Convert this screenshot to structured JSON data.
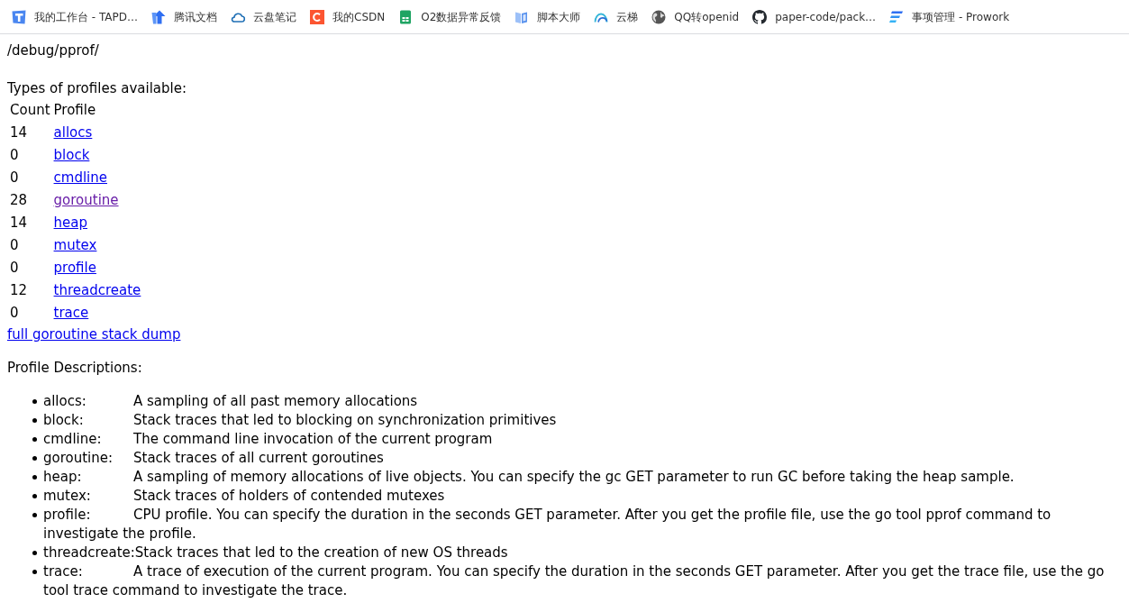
{
  "bookmarks": [
    {
      "label": "我的工作台 - TAPD…"
    },
    {
      "label": "腾讯文档"
    },
    {
      "label": "云盘笔记"
    },
    {
      "label": "我的CSDN"
    },
    {
      "label": "O2数据异常反馈"
    },
    {
      "label": "脚本大师"
    },
    {
      "label": "云梯"
    },
    {
      "label": "QQ转openid"
    },
    {
      "label": "paper-code/pack…"
    },
    {
      "label": "事项管理 - Prowork"
    }
  ],
  "path": "/debug/pprof/",
  "types_heading": "Types of profiles available:",
  "table": {
    "columns": [
      "Count",
      "Profile"
    ],
    "rows": [
      {
        "count": "14",
        "profile": "allocs",
        "visited": false
      },
      {
        "count": "0",
        "profile": "block",
        "visited": false
      },
      {
        "count": "0",
        "profile": "cmdline",
        "visited": false
      },
      {
        "count": "28",
        "profile": "goroutine",
        "visited": true
      },
      {
        "count": "14",
        "profile": "heap",
        "visited": false
      },
      {
        "count": "0",
        "profile": "mutex",
        "visited": false
      },
      {
        "count": "0",
        "profile": "profile",
        "visited": false
      },
      {
        "count": "12",
        "profile": "threadcreate",
        "visited": false
      },
      {
        "count": "0",
        "profile": "trace",
        "visited": false
      }
    ]
  },
  "full_dump_link": "full goroutine stack dump",
  "descriptions_heading": "Profile Descriptions:",
  "descriptions": [
    {
      "name": "allocs:",
      "text": "A sampling of all past memory allocations"
    },
    {
      "name": "block:",
      "text": "Stack traces that led to blocking on synchronization primitives"
    },
    {
      "name": "cmdline:",
      "text": "The command line invocation of the current program"
    },
    {
      "name": "goroutine:",
      "text": "Stack traces of all current goroutines"
    },
    {
      "name": "heap:",
      "text": "A sampling of memory allocations of live objects. You can specify the gc GET parameter to run GC before taking the heap sample."
    },
    {
      "name": "mutex:",
      "text": "Stack traces of holders of contended mutexes"
    },
    {
      "name": "profile:",
      "text": "CPU profile. You can specify the duration in the seconds GET parameter. After you get the profile file, use the go tool pprof command to investigate the profile."
    },
    {
      "name": "threadcreate:",
      "text": "Stack traces that led to the creation of new OS threads"
    },
    {
      "name": "trace:",
      "text": "A trace of execution of the current program. You can specify the duration in the seconds GET parameter. After you get the trace file, use the go tool trace command to investigate the trace."
    }
  ]
}
